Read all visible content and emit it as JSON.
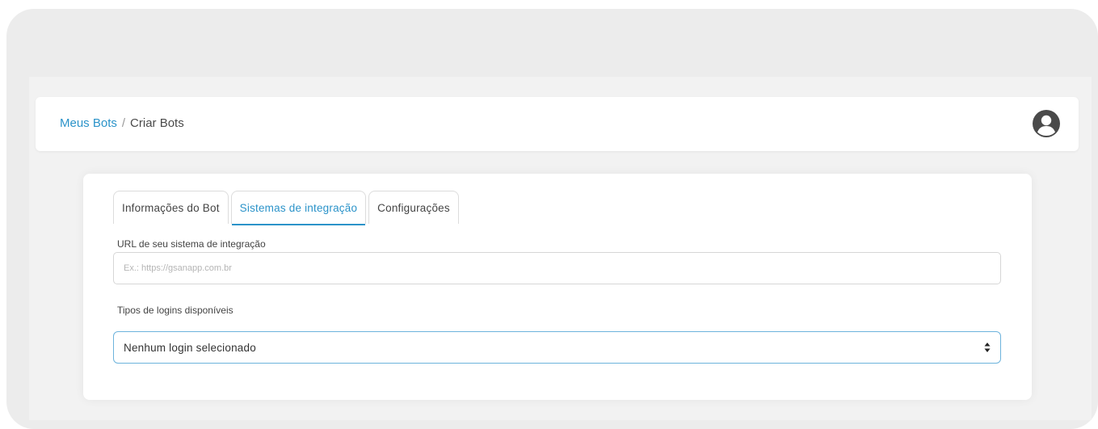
{
  "breadcrumb": {
    "link": "Meus Bots",
    "separator": "/",
    "current": "Criar Bots"
  },
  "header": {
    "avatar_icon": "user-circle-icon"
  },
  "tabs": [
    {
      "label": "Informações do Bot",
      "active": false
    },
    {
      "label": "Sistemas de integração",
      "active": true
    },
    {
      "label": "Configurações",
      "active": false
    }
  ],
  "form": {
    "url_label": "URL de seu sistema de integração",
    "url_placeholder": "Ex.: https://gsanapp.com.br",
    "url_value": "",
    "logins_label": "Tipos de logins disponíveis",
    "logins_selected": "Nenhum login selecionado"
  },
  "colors": {
    "accent": "#2b93c9",
    "select_border": "#6db3dc",
    "background": "#ececec"
  }
}
